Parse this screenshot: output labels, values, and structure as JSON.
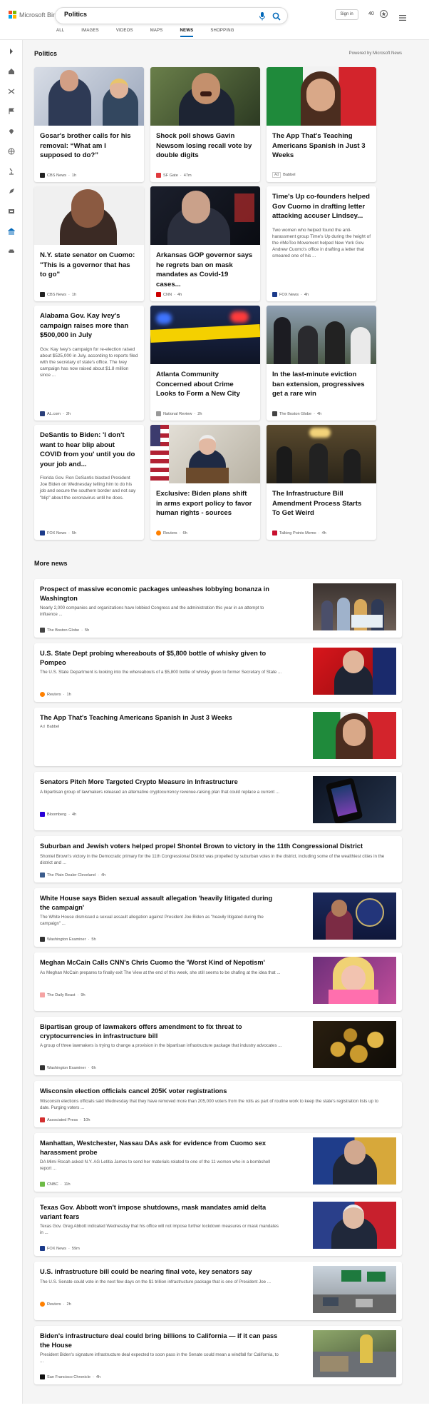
{
  "header": {
    "brand": "Microsoft Bing",
    "search_value": "Politics",
    "sign_in": "Sign in",
    "points": "40",
    "tabs": [
      "ALL",
      "IMAGES",
      "VIDEOS",
      "MAPS",
      "NEWS",
      "SHOPPING"
    ],
    "active_tab": "NEWS"
  },
  "colors": {
    "accent": "#0067b8",
    "brand_red": "#f25022",
    "brand_green": "#7fba00",
    "brand_blue": "#00a4ef",
    "brand_yellow": "#ffb900"
  },
  "section": {
    "title": "Politics",
    "powered_by": "Powered by Microsoft News"
  },
  "sidebar_icons": [
    "chevron-right-icon",
    "home-icon",
    "shuffle-icon",
    "flag-icon",
    "location-icon",
    "globe-icon",
    "microscope-icon",
    "rocket-icon",
    "film-icon",
    "bank-icon",
    "car-icon"
  ],
  "cards": [
    {
      "title": "Gosar's brother calls for his removal: “What am I supposed to do?”",
      "desc": "",
      "source": "CBS News",
      "time": "1h",
      "logo_color": "#222"
    },
    {
      "title": "Shock poll shows Gavin Newsom losing recall vote by double digits",
      "desc": "",
      "source": "SF Gate",
      "time": "47m",
      "logo_color": "#e03a3e"
    },
    {
      "title": "The App That's Teaching Americans Spanish in Just 3 Weeks",
      "desc": "",
      "source": "Babbel",
      "time": "",
      "ad": "Ad",
      "logo_color": ""
    },
    {
      "title": "N.Y. state senator on Cuomo: \"This is a governor that has to go\"",
      "desc": "",
      "source": "CBS News",
      "time": "1h",
      "logo_color": "#222"
    },
    {
      "title": "Arkansas GOP governor says he regrets ban on mask mandates as Covid-19 cases...",
      "desc": "",
      "source": "CNN",
      "time": "4h",
      "logo_color": "#cc0000"
    },
    {
      "title": "Time's Up co-founders helped Gov Cuomo in drafting letter attacking accuser Lindsey...",
      "desc": "Two women who helped found the anti-harassment group Time's Up during the height of the #MeToo Movement helped New York Gov. Andrew Cuomo's office in drafting a letter that smeared one of his ...",
      "source": "FOX News",
      "time": "4h",
      "logo_color": "#1b3a8a"
    },
    {
      "title": "Alabama Gov. Kay Ivey's campaign raises more than $500,000 in July",
      "desc": "Gov. Kay Ivey's campaign for re-election raised about $525,000 in July, according to reports filed with the secretary of state's office. The Ivey campaign has now raised about $1.8 million since ...",
      "source": "AL.com",
      "time": "2h",
      "logo_color": "#2a3f7a"
    },
    {
      "title": "Atlanta Community Concerned about Crime Looks to Form a New City",
      "desc": "",
      "source": "National Review",
      "time": "2h",
      "logo_color": "#999"
    },
    {
      "title": "In the last-minute eviction ban extension, progressives get a rare win",
      "desc": "",
      "source": "The Boston Globe",
      "time": "4h",
      "logo_color": "#444"
    },
    {
      "title": "DeSantis to Biden: 'I don't want to hear blip about COVID from you' until you do your job and...",
      "desc": "Florida Gov. Ron DeSantis blasted President Joe Biden on Wednesday telling him to do his job and secure the southern border and not say \"blip\" about the coronavirus until he does.",
      "source": "FOX News",
      "time": "5h",
      "logo_color": "#1b3a8a"
    },
    {
      "title": "Exclusive: Biden plans shift in arms export policy to favor human rights - sources",
      "desc": "",
      "source": "Reuters",
      "time": "6h",
      "logo_color": "#ff8000"
    },
    {
      "title": "The Infrastructure Bill Amendment Process Starts To Get Weird",
      "desc": "",
      "source": "Talking Points Memo",
      "time": "4h",
      "logo_color": "#c8102e"
    }
  ],
  "more_news": {
    "title": "More news",
    "items": [
      {
        "title": "Prospect of massive economic packages unleashes lobbying bonanza in Washington",
        "desc": "Nearly 2,000 companies and organizations have lobbied Congress and the administration this year in an attempt to influence ...",
        "source": "The Boston Globe",
        "time": "5h",
        "has_image": true,
        "logo_color": "#444"
      },
      {
        "title": "U.S. State Dept probing whereabouts of $5,800 bottle of whisky given to Pompeo",
        "desc": "The U.S. State Department is looking into the whereabouts of a $5,800 bottle of whisky given to former Secretary of State ...",
        "source": "Reuters",
        "time": "1h",
        "has_image": true,
        "logo_color": "#ff8000"
      },
      {
        "title": "The App That's Teaching Americans Spanish in Just 3 Weeks",
        "desc": "",
        "source": "Babbel",
        "ad": "Ad",
        "time": "",
        "has_image": true,
        "logo_color": ""
      },
      {
        "title": "Senators Pitch More Targeted Crypto Measure in Infrastructure",
        "desc": "A bipartisan group of lawmakers released an alternative cryptocurrency revenue-raising plan that could replace a current ...",
        "source": "Bloomberg",
        "time": "4h",
        "has_image": true,
        "logo_color": "#2800d7"
      },
      {
        "title": "Suburban and Jewish voters helped propel Shontel Brown to victory in the 11th Congressional District",
        "desc": "Shontel Brown's victory in the Democratic primary for the 11th Congressional District was propelled by suburban votes in the district, including some of the wealthiest cities in the district and ...",
        "source": "The Plain Dealer Cleveland",
        "time": "4h",
        "has_image": false,
        "logo_color": "#3b5c8c"
      },
      {
        "title": "White House says Biden sexual assault allegation 'heavily litigated during the campaign'",
        "desc": "The White House dismissed a sexual assault allegation against President Joe Biden as \"heavily litigated during the campaign\" ...",
        "source": "Washington Examiner",
        "time": "5h",
        "has_image": true,
        "logo_color": "#333"
      },
      {
        "title": "Meghan McCain Calls CNN's Chris Cuomo the 'Worst Kind of Nepotism'",
        "desc": "As Meghan McCain prepares to finally exit The View at the end of this week, she still seems to be chafing at the idea that ...",
        "source": "The Daily Beast",
        "time": "9h",
        "has_image": true,
        "logo_color": "#f5a3a3"
      },
      {
        "title": "Bipartisan group of lawmakers offers amendment to fix threat to cryptocurrencies in infrastructure bill",
        "desc": "A group of three lawmakers is trying to change a provision in the bipartisan infrastructure package that industry advocates ...",
        "source": "Washington Examiner",
        "time": "6h",
        "has_image": true,
        "logo_color": "#333"
      },
      {
        "title": "Wisconsin election officials cancel 205K voter registrations",
        "desc": "Wisconsin elections officials said Wednesday that they have removed more than 205,000 voters from the rolls as part of routine work to keep the state's registration lists up to date. Purging voters ...",
        "source": "Associated Press",
        "time": "10h",
        "has_image": false,
        "logo_color": "#d32f2f"
      },
      {
        "title": "Manhattan, Westchester, Nassau DAs ask for evidence from Cuomo sex harassment probe",
        "desc": "DA Mimi Rocah asked N.Y. AG Letitia James to send her materials related to one of the 11 women who in a bombshell report ...",
        "source": "CNBC",
        "time": "11h",
        "has_image": true,
        "logo_color": "#6dbb46"
      },
      {
        "title": "Texas Gov. Abbott won't impose shutdowns, mask mandates amid delta variant fears",
        "desc": "Texas Gov. Greg Abbott indicated Wednesday that his office will not impose further lockdown measures or mask mandates in ...",
        "source": "FOX News",
        "time": "59m",
        "has_image": true,
        "logo_color": "#1b3a8a"
      },
      {
        "title": "U.S. infrastructure bill could be nearing final vote, key senators say",
        "desc": "The U.S. Senate could vote in the next few days on the $1 trillion infrastructure package that is one of President Joe ...",
        "source": "Reuters",
        "time": "2h",
        "has_image": true,
        "logo_color": "#ff8000"
      },
      {
        "title": "Biden's infrastructure deal could bring billions to California — if it can pass the House",
        "desc": "President Biden's signature infrastructure deal expected to soon pass in the Senate could mean a windfall for California, to ...",
        "source": "San Francisco Chronicle",
        "time": "4h",
        "has_image": true,
        "logo_color": "#111"
      }
    ]
  }
}
